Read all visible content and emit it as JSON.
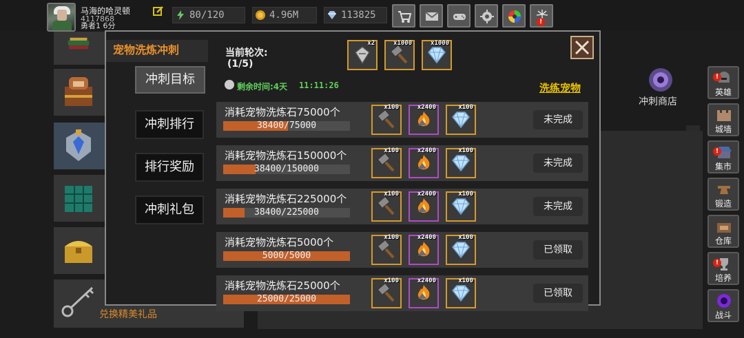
{
  "player": {
    "name": "马海的哈灵顿",
    "id": "4117868",
    "title": "勇者1 6分"
  },
  "resources": {
    "energy": "80/120",
    "gold": "4.96M",
    "gems": "113825"
  },
  "top_buttons": [
    "shop-cart-icon",
    "mail-icon",
    "gamepad-icon",
    "settings-gear-icon",
    "color-wheel-icon",
    "fireworks-icon"
  ],
  "background": {
    "list_label_bottom": "兑换精美礼品",
    "shop_label": "冲刺商店"
  },
  "right_nav": [
    {
      "label": "英雄",
      "icon": "hero-helmet-icon",
      "alert": true
    },
    {
      "label": "城墙",
      "icon": "city-wall-icon",
      "alert": false
    },
    {
      "label": "集市",
      "icon": "market-icon",
      "alert": true
    },
    {
      "label": "锻造",
      "icon": "anvil-icon",
      "alert": false
    },
    {
      "label": "仓库",
      "icon": "warehouse-icon",
      "alert": false
    },
    {
      "label": "培养",
      "icon": "trophy-icon",
      "alert": true
    },
    {
      "label": "战斗",
      "icon": "battle-portal-icon",
      "alert": false
    }
  ],
  "modal": {
    "title": "宠物洗炼冲刺",
    "tabs": [
      "冲刺目标",
      "冲刺排行",
      "排行奖励",
      "冲刺礼包"
    ],
    "active_tab": "冲刺目标",
    "round_label": "当前轮次:",
    "round_value": "(1/5)",
    "round_rewards": [
      {
        "qty": "x2",
        "icon": "silver-scroll-icon"
      },
      {
        "qty": "x1000",
        "icon": "hammer-icon"
      },
      {
        "qty": "x1000",
        "icon": "diamond-icon"
      }
    ],
    "timer_label": "剩余时间:4天",
    "timer_value": "11:11:26",
    "refine_link": "洗练宠物",
    "tasks": [
      {
        "desc": "消耗宠物洗炼石75000个",
        "progress_text": "38400/75000",
        "progress": 0.512,
        "status": "未完成",
        "rewards": [
          {
            "qty": "x100",
            "icon": "hammer-icon"
          },
          {
            "qty": "x2400",
            "icon": "fire-stone-icon"
          },
          {
            "qty": "x100",
            "icon": "diamond-icon"
          }
        ]
      },
      {
        "desc": "消耗宠物洗炼石150000个",
        "progress_text": "38400/150000",
        "progress": 0.256,
        "status": "未完成",
        "rewards": [
          {
            "qty": "x100",
            "icon": "hammer-icon"
          },
          {
            "qty": "x2400",
            "icon": "fire-stone-icon"
          },
          {
            "qty": "x100",
            "icon": "diamond-icon"
          }
        ]
      },
      {
        "desc": "消耗宠物洗炼石225000个",
        "progress_text": "38400/225000",
        "progress": 0.171,
        "status": "未完成",
        "rewards": [
          {
            "qty": "x100",
            "icon": "hammer-icon"
          },
          {
            "qty": "x2400",
            "icon": "fire-stone-icon"
          },
          {
            "qty": "x100",
            "icon": "diamond-icon"
          }
        ]
      },
      {
        "desc": "消耗宠物洗炼石5000个",
        "progress_text": "5000/5000",
        "progress": 1.0,
        "status": "已领取",
        "rewards": [
          {
            "qty": "x100",
            "icon": "hammer-icon"
          },
          {
            "qty": "x2400",
            "icon": "fire-stone-icon"
          },
          {
            "qty": "x100",
            "icon": "diamond-icon"
          }
        ]
      },
      {
        "desc": "消耗宠物洗炼石25000个",
        "progress_text": "25000/25000",
        "progress": 1.0,
        "status": "已领取",
        "rewards": [
          {
            "qty": "x100",
            "icon": "hammer-icon"
          },
          {
            "qty": "x2400",
            "icon": "fire-stone-icon"
          },
          {
            "qty": "x100",
            "icon": "diamond-icon"
          }
        ]
      }
    ]
  },
  "colors": {
    "accent_orange": "#e8902c",
    "progress_fill": "#c2602a",
    "timer_green": "#5fd05a",
    "link_yellow": "#e8c400",
    "slot_gold": "#d69a2a",
    "slot_purple": "#b04ac8"
  }
}
